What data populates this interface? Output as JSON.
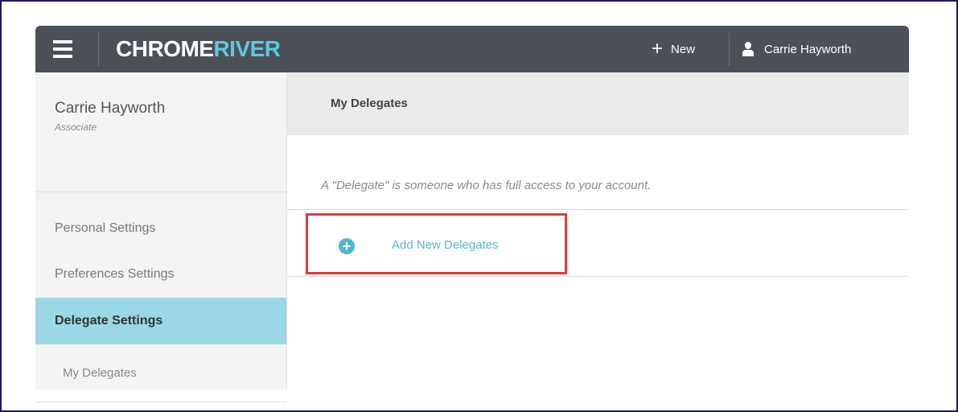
{
  "header": {
    "logo_part1": "CHROME",
    "logo_part2": "RIVER",
    "new_label": "New",
    "user_name": "Carrie Hayworth"
  },
  "sidebar": {
    "profile_name": "Carrie Hayworth",
    "profile_role": "Associate",
    "items": [
      {
        "label": "Personal Settings"
      },
      {
        "label": "Preferences Settings"
      },
      {
        "label": "Delegate Settings"
      }
    ],
    "sub_items": [
      {
        "label": "My Delegates"
      }
    ]
  },
  "main": {
    "title": "My Delegates",
    "description": "A \"Delegate\" is someone who has full access to your account.",
    "add_label": "Add New Delegates"
  },
  "colors": {
    "topbar": "#4b5157",
    "accent": "#5cc8e0",
    "active_nav": "#9bd7e6",
    "highlight_box": "#e53a3a"
  }
}
